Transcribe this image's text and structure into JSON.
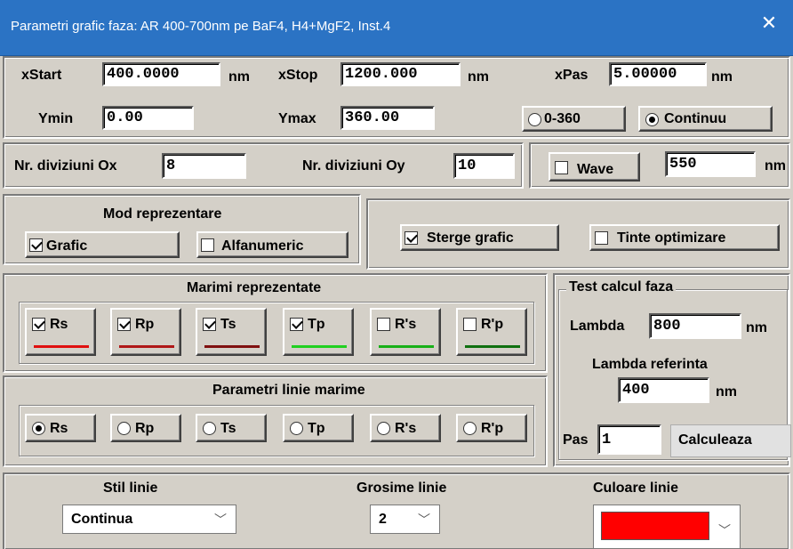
{
  "title": "Parametri grafic faza: AR 400-700nm pe BaF4, H4+MgF2, Inst.4",
  "range": {
    "xstart_label": "xStart",
    "xstart_value": "400.0000",
    "xstart_unit": "nm",
    "xstop_label": "xStop",
    "xstop_value": "1200.000",
    "xstop_unit": "nm",
    "xpas_label": "xPas",
    "xpas_value": "5.00000",
    "xpas_unit": "nm",
    "ymin_label": "Ymin",
    "ymin_value": "0.00",
    "ymax_label": "Ymax",
    "ymax_value": "360.00",
    "mode_0360": "0-360",
    "mode_continuu": "Continuu"
  },
  "divisions": {
    "ox_label": "Nr. diviziuni Ox",
    "ox_value": "8",
    "oy_label": "Nr. diviziuni Oy",
    "oy_value": "10"
  },
  "wave": {
    "label": "Wave",
    "value": "550",
    "unit": "nm"
  },
  "mod": {
    "title": "Mod reprezentare",
    "grafic": "Grafic",
    "alfanumeric": "Alfanumeric"
  },
  "options": {
    "sterge": "Sterge grafic",
    "tinte": "Tinte optimizare"
  },
  "marimi": {
    "title": "Marimi reprezentate",
    "items": [
      {
        "label": "Rs",
        "checked": true,
        "color": "#e01010"
      },
      {
        "label": "Rp",
        "checked": true,
        "color": "#b01818"
      },
      {
        "label": "Ts",
        "checked": true,
        "color": "#801010"
      },
      {
        "label": "Tp",
        "checked": true,
        "color": "#20d020"
      },
      {
        "label": "R's",
        "checked": false,
        "color": "#18b018"
      },
      {
        "label": "R'p",
        "checked": false,
        "color": "#107010"
      }
    ]
  },
  "linie": {
    "title": "Parametri linie marime",
    "items": [
      "Rs",
      "Rp",
      "Ts",
      "Tp",
      "R's",
      "R'p"
    ]
  },
  "test": {
    "title": "Test calcul faza",
    "lambda_label": "Lambda",
    "lambda_value": "800",
    "lambda_unit": "nm",
    "lref_label": "Lambda referinta",
    "lref_value": "400",
    "lref_unit": "nm",
    "pas_label": "Pas",
    "pas_value": "1",
    "calc_button": "Calculeaza"
  },
  "style": {
    "stil_label": "Stil linie",
    "stil_value": "Continua",
    "grosime_label": "Grosime linie",
    "grosime_value": "2",
    "culoare_label": "Culoare linie",
    "culoare_value": "#ff0000"
  }
}
